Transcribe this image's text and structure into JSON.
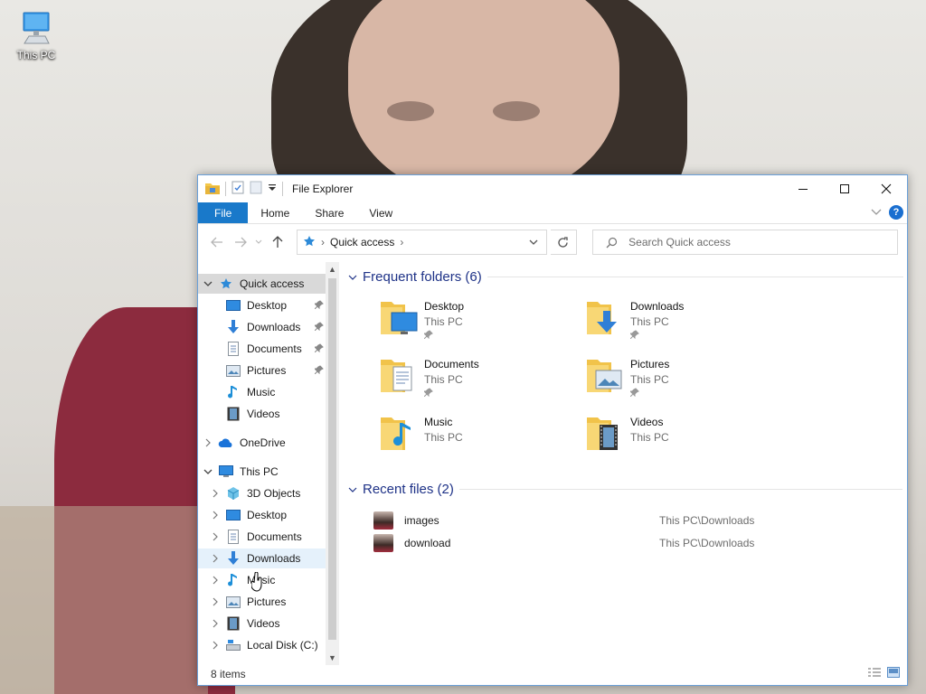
{
  "desktop": {
    "icon_label": "This PC"
  },
  "window": {
    "title": "File Explorer",
    "ribbon_tabs": [
      "File",
      "Home",
      "Share",
      "View"
    ],
    "address": {
      "location": "Quick access",
      "search_placeholder": "Search Quick access"
    },
    "nav": {
      "quick_access": "Quick access",
      "quick_items": [
        {
          "label": "Desktop",
          "icon": "desktop-icon",
          "pinned": true
        },
        {
          "label": "Downloads",
          "icon": "download-icon",
          "pinned": true
        },
        {
          "label": "Documents",
          "icon": "document-icon",
          "pinned": true
        },
        {
          "label": "Pictures",
          "icon": "pictures-icon",
          "pinned": true
        },
        {
          "label": "Music",
          "icon": "music-icon",
          "pinned": false
        },
        {
          "label": "Videos",
          "icon": "videos-icon",
          "pinned": false
        }
      ],
      "onedrive": "OneDrive",
      "this_pc": "This PC",
      "pc_items": [
        {
          "label": "3D Objects",
          "icon": "3d-objects-icon"
        },
        {
          "label": "Desktop",
          "icon": "desktop-icon"
        },
        {
          "label": "Documents",
          "icon": "document-icon"
        },
        {
          "label": "Downloads",
          "icon": "download-icon"
        },
        {
          "label": "Music",
          "icon": "music-icon"
        },
        {
          "label": "Pictures",
          "icon": "pictures-icon"
        },
        {
          "label": "Videos",
          "icon": "videos-icon"
        },
        {
          "label": "Local Disk (C:)",
          "icon": "local-disk-icon"
        }
      ]
    },
    "frequent": {
      "header": "Frequent folders (6)",
      "folders": [
        {
          "name": "Desktop",
          "location": "This PC",
          "pinned": true,
          "icon": "desktop-folder-icon"
        },
        {
          "name": "Downloads",
          "location": "This PC",
          "pinned": true,
          "icon": "downloads-folder-icon"
        },
        {
          "name": "Documents",
          "location": "This PC",
          "pinned": true,
          "icon": "documents-folder-icon"
        },
        {
          "name": "Pictures",
          "location": "This PC",
          "pinned": true,
          "icon": "pictures-folder-icon"
        },
        {
          "name": "Music",
          "location": "This PC",
          "pinned": false,
          "icon": "music-folder-icon"
        },
        {
          "name": "Videos",
          "location": "This PC",
          "pinned": false,
          "icon": "videos-folder-icon"
        }
      ]
    },
    "recent": {
      "header": "Recent files (2)",
      "files": [
        {
          "name": "images",
          "path": "This PC\\Downloads"
        },
        {
          "name": "download",
          "path": "This PC\\Downloads"
        }
      ]
    },
    "status": {
      "items": "8 items"
    },
    "colors": {
      "accent": "#1979ca",
      "group_header": "#1e3287",
      "selection": "#d9d9d9",
      "hover": "#e5f1fb"
    }
  }
}
